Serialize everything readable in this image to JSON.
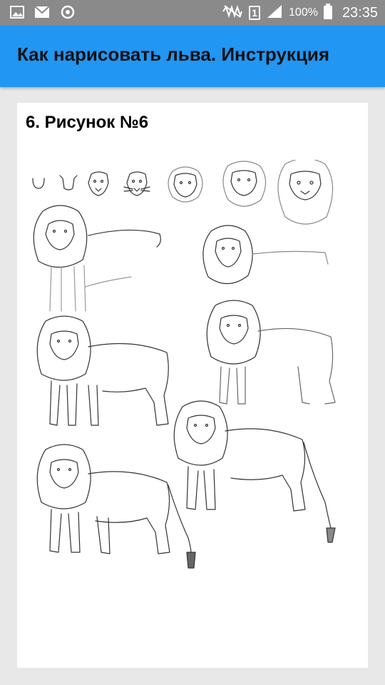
{
  "status_bar": {
    "battery_percent": "100%",
    "time": "23:35",
    "sim_slot": "1",
    "icons": [
      "image-icon",
      "mail-icon",
      "sync-icon",
      "mute-icon",
      "signal-icon",
      "battery-icon"
    ]
  },
  "app_bar": {
    "title": "Как нарисовать льва. Инструкция",
    "background": "#2196f3"
  },
  "content": {
    "section_title": "6. Рисунок №6",
    "illustration_icon": "lion-drawing-steps-illustration"
  }
}
